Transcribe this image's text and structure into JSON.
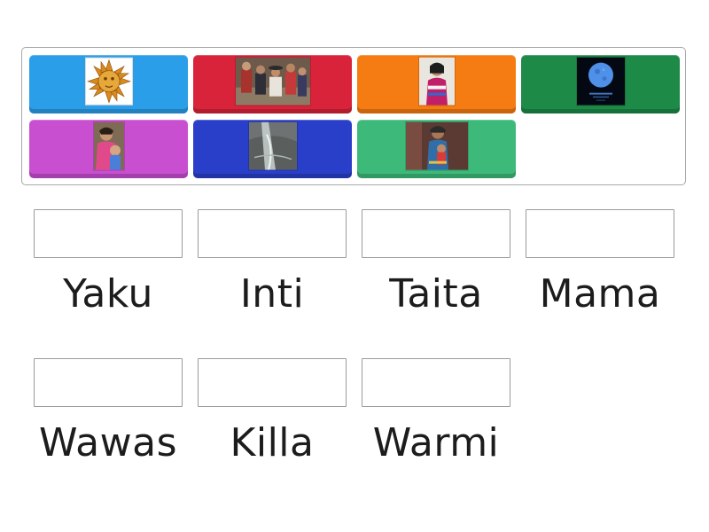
{
  "tiles": [
    {
      "image": "inti-sun-image",
      "color": "#2a9ee8"
    },
    {
      "image": "family-gathering-image",
      "color": "#d9233a"
    },
    {
      "image": "andean-woman-image",
      "color": "#f57c12"
    },
    {
      "image": "full-moon-image",
      "color": "#1d8a47"
    },
    {
      "image": "mother-and-child-image",
      "color": "#c94fd1"
    },
    {
      "image": "water-stream-image",
      "color": "#2a3fc9"
    },
    {
      "image": "father-with-child-image",
      "color": "#3dba7a"
    }
  ],
  "targets": [
    {
      "label": "Yaku"
    },
    {
      "label": "Inti"
    },
    {
      "label": "Taita"
    },
    {
      "label": "Mama"
    },
    {
      "label": "Wawas"
    },
    {
      "label": "Killa"
    },
    {
      "label": "Warmi"
    }
  ]
}
